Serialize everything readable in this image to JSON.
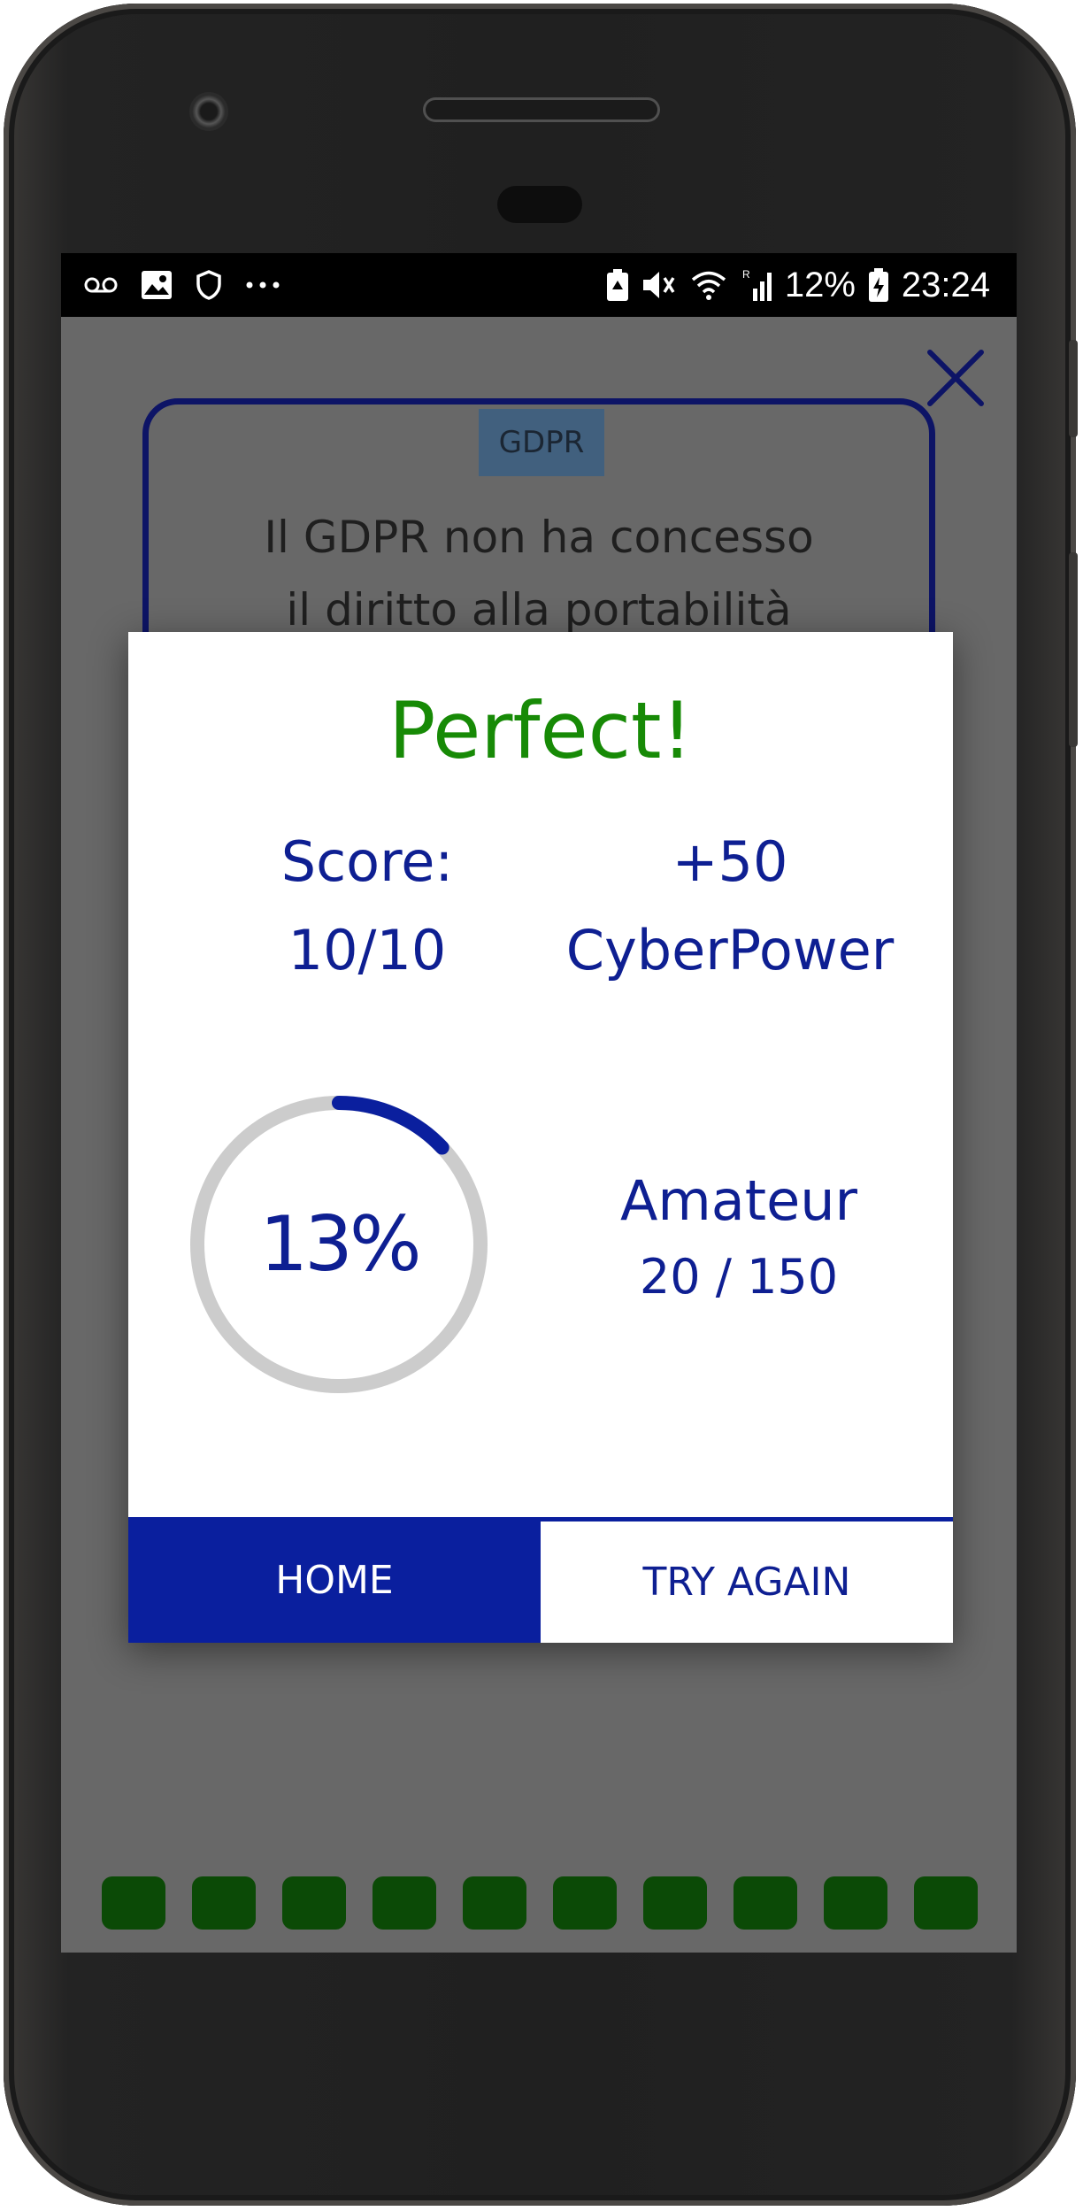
{
  "status_bar": {
    "battery_percent": "12%",
    "time": "23:24",
    "icons_left": [
      "voicemail-icon",
      "image-icon",
      "shield-icon",
      "more-icon"
    ],
    "icons_right": [
      "battery-saver-icon",
      "mute-icon",
      "wifi-icon",
      "signal-icon",
      "battery-charging-icon"
    ]
  },
  "background_card": {
    "tag": "GDPR",
    "question_line1": "Il GDPR non ha concesso",
    "question_line2": "il diritto alla portabilità"
  },
  "result_dialog": {
    "title": "Perfect!",
    "score_label": "Score:",
    "score_value": "10/10",
    "reward_value": "+50",
    "reward_label": "CyberPower",
    "progress_text": "13%",
    "progress_fraction": 0.13,
    "level_name": "Amateur",
    "level_points": "20 / 150",
    "home_button": "HOME",
    "try_again_button": "TRY AGAIN"
  },
  "answer_indicators": {
    "count": 10,
    "color": "#0b4a06"
  },
  "colors": {
    "accent_blue": "#0a1f9e",
    "text_blue": "#0e1f92",
    "success_green": "#178a06",
    "ring_track": "#cccccc"
  }
}
